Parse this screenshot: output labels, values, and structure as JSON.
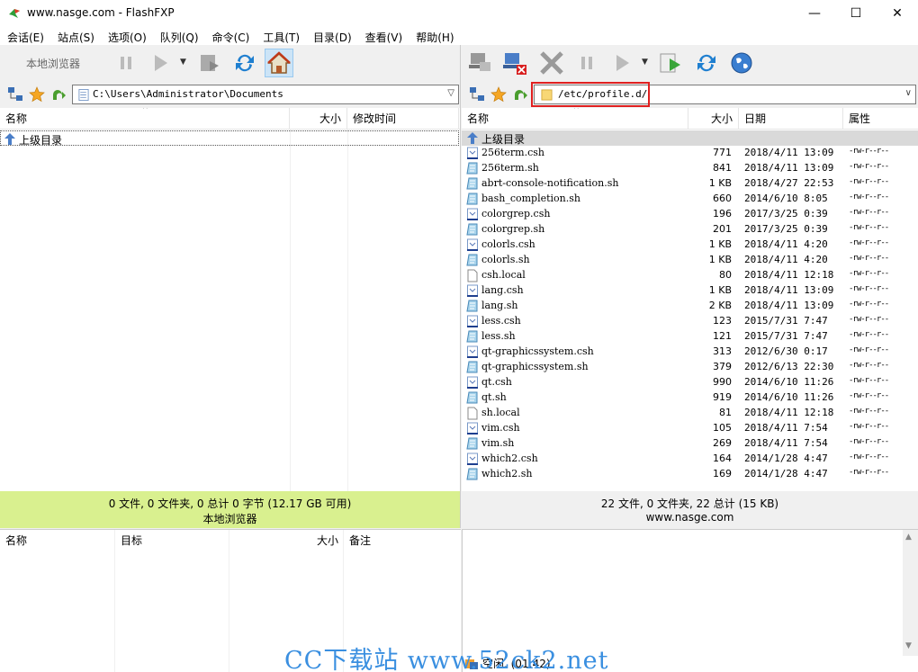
{
  "window": {
    "title": "www.nasge.com - FlashFXP",
    "minimize": "—",
    "maximize": "☐",
    "close": "✕"
  },
  "menu": [
    "会话(E)",
    "站点(S)",
    "选项(O)",
    "队列(Q)",
    "命令(C)",
    "工具(T)",
    "目录(D)",
    "查看(V)",
    "帮助(H)"
  ],
  "left": {
    "toolbar_label": "本地浏览器",
    "path": "C:\\Users\\Administrator\\Documents",
    "columns": {
      "name": "名称",
      "size": "大小",
      "modified": "修改时间"
    },
    "parent": "上级目录",
    "status_line1": "0 文件, 0 文件夹, 0 总计 0 字节 (12.17 GB 可用)",
    "status_line2": "本地浏览器"
  },
  "right": {
    "path": "/etc/profile.d/",
    "columns": {
      "name": "名称",
      "size": "大小",
      "date": "日期",
      "attr": "属性"
    },
    "parent": "上级目录",
    "files": [
      {
        "name": "256term.csh",
        "size": "771",
        "date": "2018/4/11 13:09",
        "attr": "-rw-r--r--",
        "icon": "script"
      },
      {
        "name": "256term.sh",
        "size": "841",
        "date": "2018/4/11 13:09",
        "attr": "-rw-r--r--",
        "icon": "shell"
      },
      {
        "name": "abrt-console-notification.sh",
        "size": "1 KB",
        "date": "2018/4/27 22:53",
        "attr": "-rw-r--r--",
        "icon": "shell"
      },
      {
        "name": "bash_completion.sh",
        "size": "660",
        "date": "2014/6/10 8:05",
        "attr": "-rw-r--r--",
        "icon": "shell"
      },
      {
        "name": "colorgrep.csh",
        "size": "196",
        "date": "2017/3/25 0:39",
        "attr": "-rw-r--r--",
        "icon": "script"
      },
      {
        "name": "colorgrep.sh",
        "size": "201",
        "date": "2017/3/25 0:39",
        "attr": "-rw-r--r--",
        "icon": "shell"
      },
      {
        "name": "colorls.csh",
        "size": "1 KB",
        "date": "2018/4/11 4:20",
        "attr": "-rw-r--r--",
        "icon": "script"
      },
      {
        "name": "colorls.sh",
        "size": "1 KB",
        "date": "2018/4/11 4:20",
        "attr": "-rw-r--r--",
        "icon": "shell"
      },
      {
        "name": "csh.local",
        "size": "80",
        "date": "2018/4/11 12:18",
        "attr": "-rw-r--r--",
        "icon": "blank"
      },
      {
        "name": "lang.csh",
        "size": "1 KB",
        "date": "2018/4/11 13:09",
        "attr": "-rw-r--r--",
        "icon": "script"
      },
      {
        "name": "lang.sh",
        "size": "2 KB",
        "date": "2018/4/11 13:09",
        "attr": "-rw-r--r--",
        "icon": "shell"
      },
      {
        "name": "less.csh",
        "size": "123",
        "date": "2015/7/31 7:47",
        "attr": "-rw-r--r--",
        "icon": "script"
      },
      {
        "name": "less.sh",
        "size": "121",
        "date": "2015/7/31 7:47",
        "attr": "-rw-r--r--",
        "icon": "shell"
      },
      {
        "name": "qt-graphicssystem.csh",
        "size": "313",
        "date": "2012/6/30 0:17",
        "attr": "-rw-r--r--",
        "icon": "script"
      },
      {
        "name": "qt-graphicssystem.sh",
        "size": "379",
        "date": "2012/6/13 22:30",
        "attr": "-rw-r--r--",
        "icon": "shell"
      },
      {
        "name": "qt.csh",
        "size": "990",
        "date": "2014/6/10 11:26",
        "attr": "-rw-r--r--",
        "icon": "script"
      },
      {
        "name": "qt.sh",
        "size": "919",
        "date": "2014/6/10 11:26",
        "attr": "-rw-r--r--",
        "icon": "shell"
      },
      {
        "name": "sh.local",
        "size": "81",
        "date": "2018/4/11 12:18",
        "attr": "-rw-r--r--",
        "icon": "blank"
      },
      {
        "name": "vim.csh",
        "size": "105",
        "date": "2018/4/11 7:54",
        "attr": "-rw-r--r--",
        "icon": "script"
      },
      {
        "name": "vim.sh",
        "size": "269",
        "date": "2018/4/11 7:54",
        "attr": "-rw-r--r--",
        "icon": "shell"
      },
      {
        "name": "which2.csh",
        "size": "164",
        "date": "2014/1/28 4:47",
        "attr": "-rw-r--r--",
        "icon": "script"
      },
      {
        "name": "which2.sh",
        "size": "169",
        "date": "2014/1/28 4:47",
        "attr": "-rw-r--r--",
        "icon": "shell"
      }
    ],
    "status_line1": "22 文件, 0 文件夹, 22 总计 (15 KB)",
    "status_line2": "www.nasge.com"
  },
  "queue": {
    "columns": [
      "名称",
      "目标",
      "大小",
      "备注"
    ]
  },
  "footer": {
    "idle": "空闲. (01:42)",
    "watermark": "CC下载站  www.52ck2.net"
  },
  "colors": {
    "local_status_bg": "#d9f08f",
    "highlight": "#e02020",
    "watermark": "#3a8fe0"
  }
}
